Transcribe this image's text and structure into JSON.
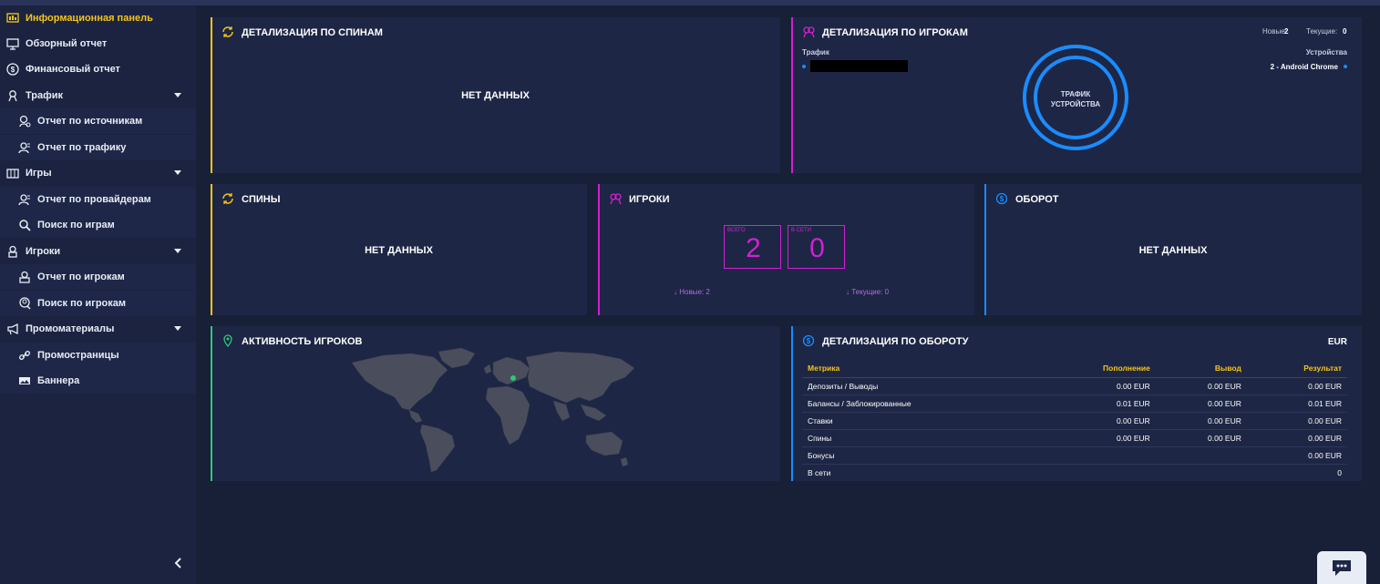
{
  "sidebar": {
    "items": [
      {
        "label": "Информационная панель",
        "icon": "dashboard-icon",
        "active": true
      },
      {
        "label": "Обзорный отчет",
        "icon": "overview-icon"
      },
      {
        "label": "Финансовый отчет",
        "icon": "dollar-icon"
      },
      {
        "label": "Трафик",
        "icon": "users-icon",
        "expandable": true
      },
      {
        "label": "Отчет по источникам",
        "icon": "source-icon",
        "sub": true
      },
      {
        "label": "Отчет по трафику",
        "icon": "user-icon",
        "sub": true
      },
      {
        "label": "Игры",
        "icon": "games-icon",
        "expandable": true
      },
      {
        "label": "Отчет по провайдерам",
        "icon": "user-icon",
        "sub": true
      },
      {
        "label": "Поиск по играм",
        "icon": "search-icon",
        "sub": true
      },
      {
        "label": "Игроки",
        "icon": "player-icon",
        "expandable": true
      },
      {
        "label": "Отчет по игрокам",
        "icon": "player-report-icon",
        "sub": true
      },
      {
        "label": "Поиск по игрокам",
        "icon": "player-search-icon",
        "sub": true
      },
      {
        "label": "Промоматериалы",
        "icon": "megaphone-icon",
        "expandable": true
      },
      {
        "label": "Промостраницы",
        "icon": "link-icon",
        "sub": true
      },
      {
        "label": "Баннера",
        "icon": "banner-icon",
        "sub": true
      }
    ]
  },
  "spins_detail": {
    "title": "ДЕТАЛИЗАЦИЯ ПО СПИНАМ",
    "empty": "НЕТ ДАННЫХ"
  },
  "players_detail": {
    "title": "ДЕТАЛИЗАЦИЯ ПО ИГРОКАМ",
    "new_label": "Новые:",
    "new_value": "2",
    "current_label": "Текущие:",
    "current_value": "0",
    "traffic_label": "Трафик",
    "devices_label": "Устройства",
    "device_item": "2 - Android Chrome",
    "circle_line1": "ТРАФИК",
    "circle_line2": "УСТРОЙСТВА"
  },
  "spins": {
    "title": "СПИНЫ",
    "empty": "НЕТ ДАННЫХ"
  },
  "players": {
    "title": "ИГРОКИ",
    "total_label": "ВСЕГО",
    "total_value": "2",
    "online_label": "В СЕТИ",
    "online_value": "0",
    "new_text": "↓ Новые: 2",
    "current_text": "↓ Текущие: 0"
  },
  "turnover": {
    "title": "ОБОРОТ",
    "empty": "НЕТ ДАННЫХ"
  },
  "activity": {
    "title": "АКТИВНОСТЬ ИГРОКОВ"
  },
  "turnover_detail": {
    "title": "ДЕТАЛИЗАЦИЯ ПО ОБОРОТУ",
    "currency": "EUR",
    "headers": [
      "Метрика",
      "Пополнение",
      "Вывод",
      "Результат"
    ],
    "rows": [
      [
        "Депозиты / Выводы",
        "0.00 EUR",
        "0.00 EUR",
        "0.00 EUR"
      ],
      [
        "Балансы / Заблокированные",
        "0.01 EUR",
        "0.00 EUR",
        "0.01 EUR"
      ],
      [
        "Ставки",
        "0.00 EUR",
        "0.00 EUR",
        "0.00 EUR"
      ],
      [
        "Спины",
        "0.00 EUR",
        "0.00 EUR",
        "0.00 EUR"
      ],
      [
        "Бонусы",
        "",
        "",
        "0.00 EUR"
      ],
      [
        "В сети",
        "",
        "",
        "0"
      ]
    ]
  },
  "colors": {
    "yellow": "#f5c518",
    "magenta": "#d41fd4",
    "blue": "#1a8cff",
    "green": "#2fc77a"
  }
}
